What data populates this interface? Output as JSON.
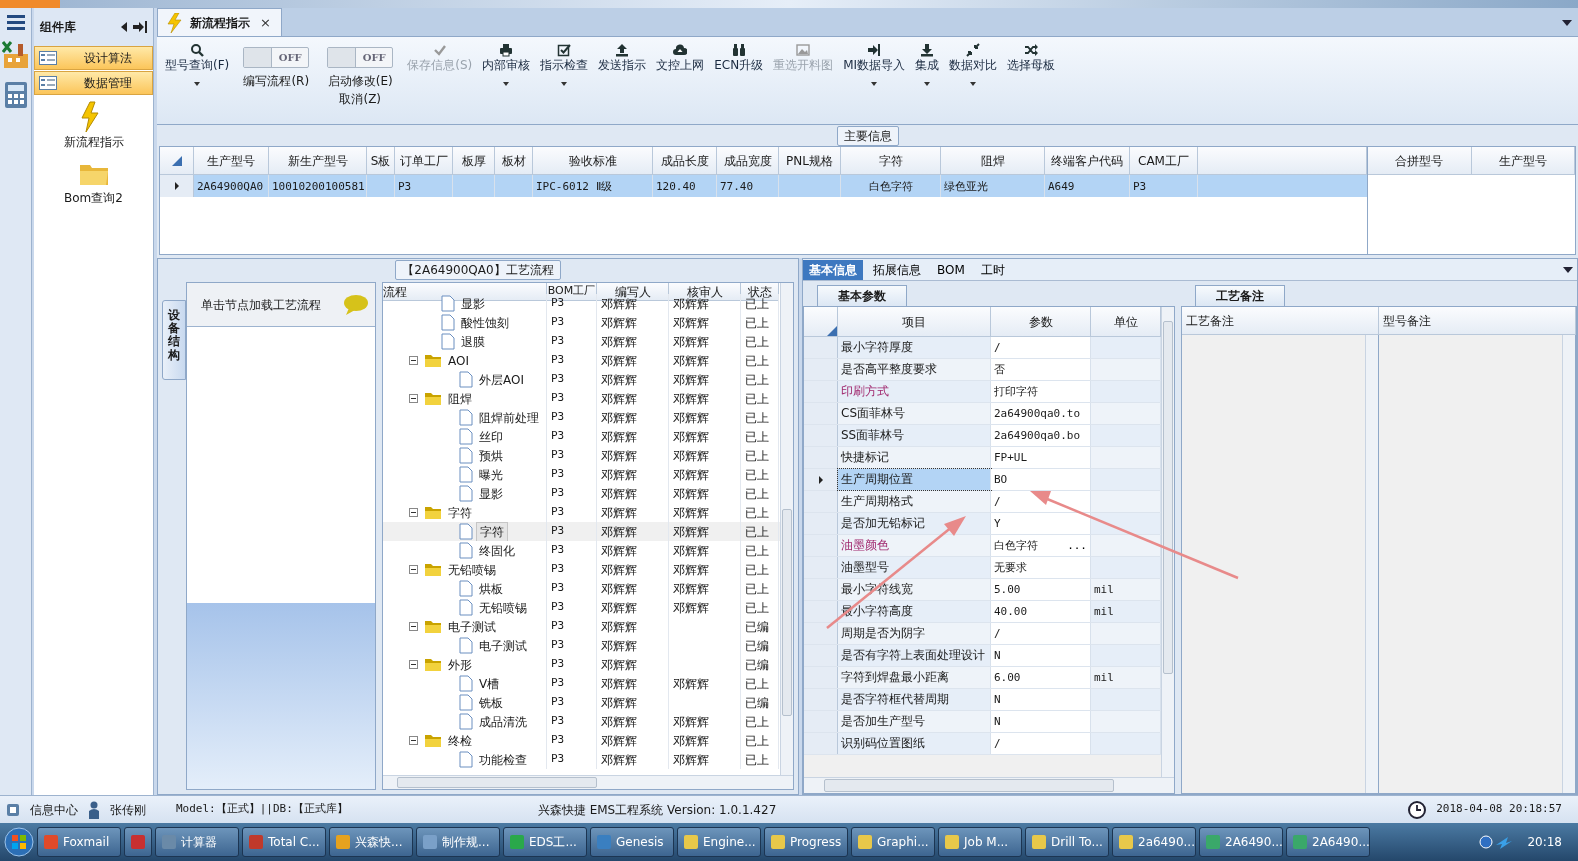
{
  "component_panel": {
    "title": "组件库",
    "groups": [
      {
        "label": "设计算法"
      },
      {
        "label": "数据管理"
      }
    ],
    "items": [
      {
        "label": "新流程指示"
      },
      {
        "label": "Bom查询2"
      }
    ]
  },
  "document_tabs": [
    {
      "label": "新流程指示",
      "selected": true,
      "close": "×"
    }
  ],
  "toolbar": [
    {
      "kind": "button",
      "label": "型号查询(F)",
      "caret": true,
      "disabled": false
    },
    {
      "kind": "toggle",
      "label": "编写流程(R)",
      "switch_text": "OFF",
      "on": false
    },
    {
      "kind": "toggle",
      "label": "启动修改(E)\n取消(Z)",
      "switch_text": "OFF",
      "on": false
    },
    {
      "kind": "button",
      "label": "保存信息(S)",
      "caret": false,
      "disabled": true
    },
    {
      "kind": "button",
      "label": "内部审核",
      "caret": true,
      "disabled": false
    },
    {
      "kind": "button",
      "label": "指示检查",
      "caret": true,
      "disabled": false
    },
    {
      "kind": "button",
      "label": "发送指示",
      "caret": false,
      "disabled": false
    },
    {
      "kind": "button",
      "label": "文控上网",
      "caret": false,
      "disabled": false
    },
    {
      "kind": "button",
      "label": "ECN升级",
      "caret": false,
      "disabled": false
    },
    {
      "kind": "button",
      "label": "重选开料图",
      "caret": false,
      "disabled": true
    },
    {
      "kind": "button",
      "label": "MI数据导入",
      "caret": true,
      "disabled": false
    },
    {
      "kind": "button",
      "label": "集成",
      "caret": true,
      "disabled": false
    },
    {
      "kind": "button",
      "label": "数据对比",
      "caret": true,
      "disabled": false
    },
    {
      "kind": "button",
      "label": "选择母板",
      "caret": false,
      "disabled": false
    }
  ],
  "main_info": {
    "title": "主要信息",
    "columns": [
      "生产型号",
      "新生产型号",
      "S板",
      "订单工厂",
      "板厚",
      "板材",
      "验收标准",
      "成品长度",
      "成品宽度",
      "PNL规格",
      "字符",
      "阻焊",
      "终端客户代码",
      "CAM工厂"
    ],
    "rows": [
      {
        "selected": true,
        "cells": [
          "2A64900QA0",
          "10010200100581",
          null,
          "P3",
          null,
          null,
          "IPC-6012 Ⅱ级",
          "120.40",
          "77.40",
          null,
          "白色字符",
          "绿色亚光",
          "A649",
          "P3"
        ]
      }
    ],
    "side_columns": [
      "合拼型号",
      "生产型号"
    ]
  },
  "process": {
    "title": "【2A64900QA0】工艺流程",
    "side_tab": "设备结构",
    "hint": "单击节点加载工艺流程",
    "columns": [
      "流程",
      "BOM工厂",
      "编写人",
      "核审人",
      "状态"
    ],
    "nodes": [
      {
        "kind": "file",
        "label": "显影",
        "bom": "P3",
        "writer": "邓辉辉",
        "reviewer": "邓辉辉",
        "status": "已上",
        "selected": false
      },
      {
        "kind": "file",
        "label": "酸性蚀刻",
        "bom": "P3",
        "writer": "邓辉辉",
        "reviewer": "邓辉辉",
        "status": "已上",
        "selected": false
      },
      {
        "kind": "file",
        "label": "退膜",
        "bom": "P3",
        "writer": "邓辉辉",
        "reviewer": "邓辉辉",
        "status": "已上",
        "selected": false
      },
      {
        "kind": "folder",
        "label": "AOI",
        "bom": "P3",
        "writer": "邓辉辉",
        "reviewer": "邓辉辉",
        "status": "已上",
        "selected": false,
        "expanded": true,
        "children": [
          {
            "kind": "file",
            "label": "外层AOI",
            "bom": "P3",
            "writer": "邓辉辉",
            "reviewer": "邓辉辉",
            "status": "已上",
            "selected": false
          }
        ]
      },
      {
        "kind": "folder",
        "label": "阻焊",
        "bom": "P3",
        "writer": "邓辉辉",
        "reviewer": "邓辉辉",
        "status": "已上",
        "selected": false,
        "expanded": true,
        "children": [
          {
            "kind": "file",
            "label": "阻焊前处理",
            "bom": "P3",
            "writer": "邓辉辉",
            "reviewer": "邓辉辉",
            "status": "已上",
            "selected": false
          },
          {
            "kind": "file",
            "label": "丝印",
            "bom": "P3",
            "writer": "邓辉辉",
            "reviewer": "邓辉辉",
            "status": "已上",
            "selected": false
          },
          {
            "kind": "file",
            "label": "预烘",
            "bom": "P3",
            "writer": "邓辉辉",
            "reviewer": "邓辉辉",
            "status": "已上",
            "selected": false
          },
          {
            "kind": "file",
            "label": "曝光",
            "bom": "P3",
            "writer": "邓辉辉",
            "reviewer": "邓辉辉",
            "status": "已上",
            "selected": false
          },
          {
            "kind": "file",
            "label": "显影",
            "bom": "P3",
            "writer": "邓辉辉",
            "reviewer": "邓辉辉",
            "status": "已上",
            "selected": false
          }
        ]
      },
      {
        "kind": "folder",
        "label": "字符",
        "bom": "P3",
        "writer": "邓辉辉",
        "reviewer": "邓辉辉",
        "status": "已上",
        "selected": false,
        "expanded": true,
        "children": [
          {
            "kind": "file",
            "label": "字符",
            "bom": "P3",
            "writer": "邓辉辉",
            "reviewer": "邓辉辉",
            "status": "已上",
            "selected": true
          },
          {
            "kind": "file",
            "label": "终固化",
            "bom": "P3",
            "writer": "邓辉辉",
            "reviewer": "邓辉辉",
            "status": "已上",
            "selected": false
          }
        ]
      },
      {
        "kind": "folder",
        "label": "无铅喷锡",
        "bom": "P3",
        "writer": "邓辉辉",
        "reviewer": "邓辉辉",
        "status": "已上",
        "selected": false,
        "expanded": true,
        "children": [
          {
            "kind": "file",
            "label": "烘板",
            "bom": "P3",
            "writer": "邓辉辉",
            "reviewer": "邓辉辉",
            "status": "已上",
            "selected": false
          },
          {
            "kind": "file",
            "label": "无铅喷锡",
            "bom": "P3",
            "writer": "邓辉辉",
            "reviewer": "邓辉辉",
            "status": "已上",
            "selected": false
          }
        ]
      },
      {
        "kind": "folder",
        "label": "电子测试",
        "bom": "P3",
        "writer": "邓辉辉",
        "status": "已编",
        "selected": false,
        "expanded": true,
        "children": [
          {
            "kind": "file",
            "label": "电子测试",
            "bom": "P3",
            "writer": "邓辉辉",
            "status": "已编",
            "selected": false
          }
        ]
      },
      {
        "kind": "folder",
        "label": "外形",
        "bom": "P3",
        "writer": "邓辉辉",
        "status": "已编",
        "selected": false,
        "expanded": true,
        "children": [
          {
            "kind": "file",
            "label": "V槽",
            "bom": "P3",
            "writer": "邓辉辉",
            "reviewer": "邓辉辉",
            "status": "已上",
            "selected": false
          },
          {
            "kind": "file",
            "label": "铣板",
            "bom": "P3",
            "writer": "邓辉辉",
            "status": "已编",
            "selected": false
          },
          {
            "kind": "file",
            "label": "成品清洗",
            "bom": "P3",
            "writer": "邓辉辉",
            "reviewer": "邓辉辉",
            "status": "已上",
            "selected": false
          }
        ]
      },
      {
        "kind": "folder",
        "label": "终检",
        "bom": "P3",
        "writer": "邓辉辉",
        "reviewer": "邓辉辉",
        "status": "已上",
        "selected": false,
        "expanded": true,
        "children": [
          {
            "kind": "file",
            "label": "功能检查",
            "bom": "P3",
            "writer": "邓辉辉",
            "reviewer": "邓辉辉",
            "status": "已上",
            "selected": false
          }
        ]
      }
    ]
  },
  "detail_tabs": [
    {
      "label": "基本信息",
      "selected": true
    },
    {
      "label": "拓展信息",
      "selected": false
    },
    {
      "label": "BOM",
      "selected": false
    },
    {
      "label": "工时",
      "selected": false
    }
  ],
  "params": {
    "tab": "基本参数",
    "columns": [
      "项目",
      "参数",
      "单位"
    ],
    "rows": [
      {
        "item": "最小字符厚度",
        "value": "/",
        "emphasis": false,
        "selected": false
      },
      {
        "item": "是否高平整度要求",
        "value": "否",
        "emphasis": false,
        "selected": false
      },
      {
        "item": "印刷方式",
        "value": "打印字符",
        "emphasis": true,
        "selected": false
      },
      {
        "item": "CS面菲林号",
        "value": "2a64900qa0.to",
        "emphasis": false,
        "selected": false
      },
      {
        "item": "SS面菲林号",
        "value": "2a64900qa0.bo",
        "emphasis": false,
        "selected": false
      },
      {
        "item": "快捷标记",
        "value": "FP+UL",
        "emphasis": false,
        "selected": false
      },
      {
        "item": "生产周期位置",
        "value": "BO",
        "emphasis": false,
        "selected": true
      },
      {
        "item": "生产周期格式",
        "value": "/",
        "emphasis": false,
        "selected": false
      },
      {
        "item": "是否加无铅标记",
        "value": "Y",
        "emphasis": false,
        "selected": false
      },
      {
        "item": "油墨颜色",
        "value": "白色字符",
        "button": "...",
        "emphasis": true,
        "selected": false
      },
      {
        "item": "油墨型号",
        "value": "无要求",
        "emphasis": false,
        "selected": false
      },
      {
        "item": "最小字符线宽",
        "value": "5.00",
        "unit": "mil",
        "emphasis": false,
        "selected": false
      },
      {
        "item": "最小字符高度",
        "value": "40.00",
        "unit": "mil",
        "emphasis": false,
        "selected": false
      },
      {
        "item": "周期是否为阴字",
        "value": "/",
        "emphasis": false,
        "selected": false
      },
      {
        "item": "是否有字符上表面处理设计",
        "value": "N",
        "emphasis": false,
        "selected": false
      },
      {
        "item": "字符到焊盘最小距离",
        "value": "6.00",
        "unit": "mil",
        "emphasis": false,
        "selected": false
      },
      {
        "item": "是否字符框代替周期",
        "value": "N",
        "emphasis": false,
        "selected": false
      },
      {
        "item": "是否加生产型号",
        "value": "N",
        "emphasis": false,
        "selected": false
      },
      {
        "item": "识别码位置图纸",
        "value": "/",
        "emphasis": false,
        "selected": false
      }
    ]
  },
  "notes": {
    "tab": "工艺备注",
    "columns": [
      "工艺备注",
      "型号备注"
    ]
  },
  "status_bar": {
    "info": "信息中心",
    "user": "张传刚",
    "model": "Model:【正式】||DB:【正式库】",
    "system": "兴森快捷 EMS工程系统 Version: 1.0.1.427",
    "datetime": "2018-04-08 20:18:57"
  },
  "taskbar": {
    "items": [
      {
        "label": "Foxmail"
      },
      {
        "kind": "icon"
      },
      {
        "label": "计算器"
      },
      {
        "label": "Total C..."
      },
      {
        "label": "兴森快..."
      },
      {
        "label": "制作规..."
      },
      {
        "label": "EDS工..."
      },
      {
        "label": "Genesis"
      },
      {
        "label": "Engine..."
      },
      {
        "label": "Progress"
      },
      {
        "label": "Graphi..."
      },
      {
        "label": "Job M..."
      },
      {
        "label": "Drill To..."
      },
      {
        "label": "2a6490..."
      },
      {
        "label": "2A6490..."
      },
      {
        "label": "2A6490..."
      }
    ],
    "clock": "20:18"
  }
}
